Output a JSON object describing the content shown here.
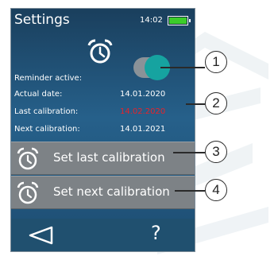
{
  "header": {
    "title": "Settings",
    "time": "14:02"
  },
  "reminder": {
    "label": "Reminder active:",
    "toggle_on": true
  },
  "info_rows": [
    {
      "label": "Actual date:",
      "value": "14.01.2020",
      "value_color": "#ffffff"
    },
    {
      "label": "Last calibration:",
      "value": "14.02.2020",
      "value_color": "#e8222a"
    },
    {
      "label": "Next calibration:",
      "value": "14.01.2021",
      "value_color": "#ffffff"
    }
  ],
  "buttons": {
    "set_last": "Set last calibration",
    "set_next": "Set next calibration"
  },
  "footer": {
    "help": "?"
  },
  "callouts": [
    "1",
    "2",
    "3",
    "4"
  ],
  "colors": {
    "accent_toggle": "#16a3a0",
    "battery": "#3ccd2a",
    "warning": "#e8222a"
  }
}
